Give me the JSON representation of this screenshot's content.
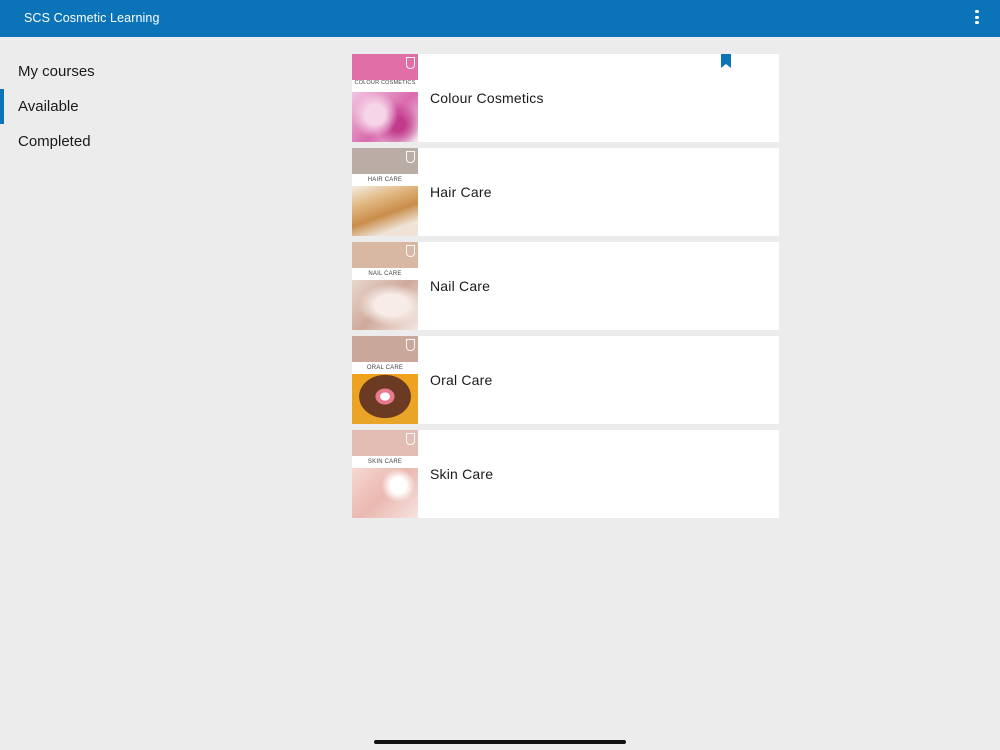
{
  "appbar": {
    "title": "SCS Cosmetic Learning",
    "menu_icon": "more-vert-icon"
  },
  "sidebar": {
    "items": [
      {
        "label": "My courses",
        "active": false
      },
      {
        "label": "Available",
        "active": true
      },
      {
        "label": "Completed",
        "active": false
      }
    ]
  },
  "courses": [
    {
      "name": "Colour Cosmetics",
      "thumb_label": "COLOUR COSMETICS",
      "bookmarked": true,
      "band_color": "#e06fa7"
    },
    {
      "name": "Hair Care",
      "thumb_label": "HAIR CARE",
      "bookmarked": false,
      "band_color": "#b9ada6"
    },
    {
      "name": "Nail Care",
      "thumb_label": "NAIL CARE",
      "bookmarked": false,
      "band_color": "#d8b8a3"
    },
    {
      "name": "Oral Care",
      "thumb_label": "ORAL CARE",
      "bookmarked": false,
      "band_color": "#c9a79a"
    },
    {
      "name": "Skin Care",
      "thumb_label": "SKIN CARE",
      "bookmarked": false,
      "band_color": "#e3bdb4"
    }
  ],
  "colors": {
    "accent": "#0b74b9",
    "background": "#ececec"
  }
}
